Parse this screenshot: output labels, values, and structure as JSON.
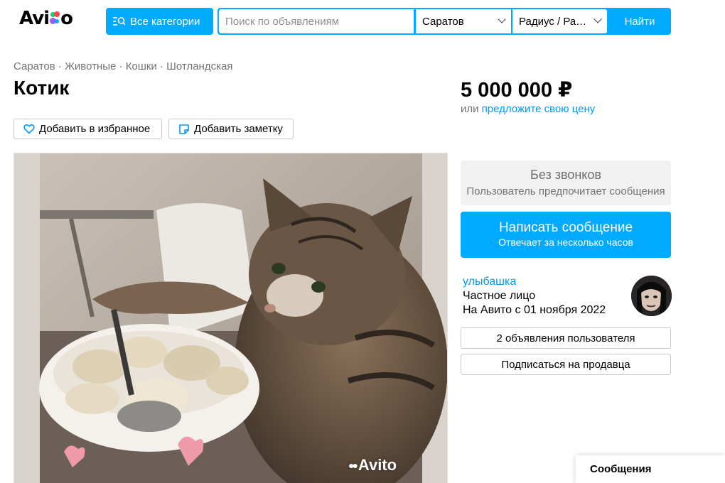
{
  "header": {
    "logo_text_left": "Avi",
    "logo_text_right": "o",
    "categories_label": "Все категории",
    "search_placeholder": "Поиск по объявлениям",
    "city": "Саратов",
    "radius": "Радиус / Ра…",
    "find_label": "Найти"
  },
  "breadcrumbs": [
    "Саратов",
    "Животные",
    "Кошки",
    "Шотландская"
  ],
  "breadcrumb_separator": " · ",
  "listing": {
    "title": "Котик",
    "favorite_label": "Добавить в избранное",
    "note_label": "Добавить заметку",
    "photo_watermark": "Avito",
    "price": "5 000 000 ₽",
    "offer_prefix": "или ",
    "offer_link": "предложите свою цену"
  },
  "contact": {
    "no_calls_title": "Без звонков",
    "no_calls_sub": "Пользователь предпочитает сообщения",
    "write_title": "Написать сообщение",
    "write_sub": "Отвечает за несколько часов"
  },
  "seller": {
    "name": "улыбашка",
    "type": "Частное лицо",
    "since": "На Авито с 01 ноября 2022",
    "listings_label": "2 объявления пользователя",
    "subscribe_label": "Подписаться на продавца"
  },
  "messages_tab": "Сообщения",
  "colors": {
    "accent": "#00aaff",
    "link": "#0099f7",
    "logo_dots": [
      "#00d36f",
      "#ff4053",
      "#965eeb",
      "#0af"
    ]
  },
  "icons": [
    "search-list-icon",
    "heart-icon",
    "note-icon",
    "chevron-down-icon"
  ]
}
